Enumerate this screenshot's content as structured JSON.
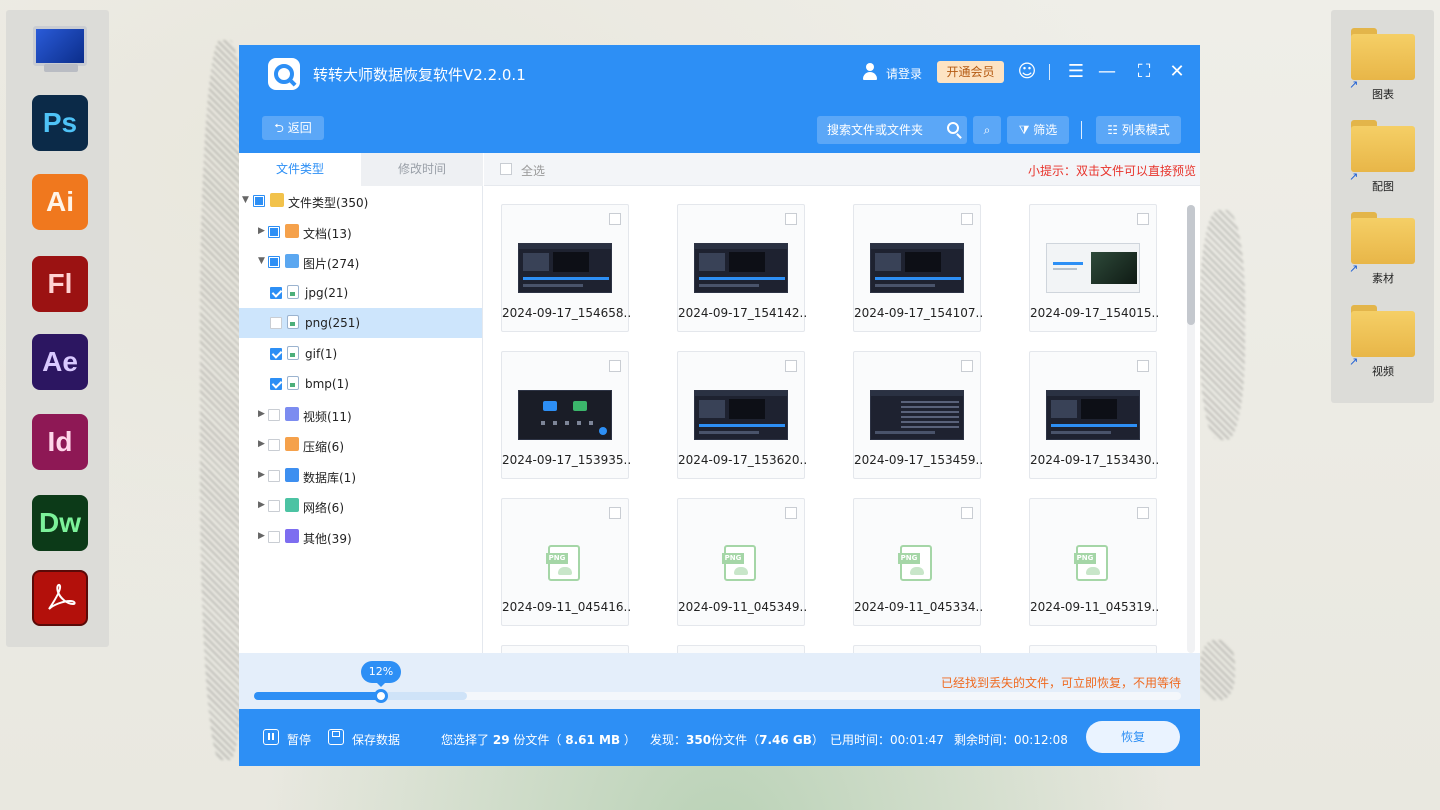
{
  "app": {
    "title": "转转大师数据恢复软件V2.2.0.1",
    "login_label": "请登录",
    "vip_label": "开通会员"
  },
  "toolbar": {
    "back_label": "返回",
    "search_placeholder": "搜索文件或文件夹",
    "filter_label": "筛选",
    "list_mode_label": "列表模式"
  },
  "tabs": [
    {
      "label": "文件类型",
      "active": true
    },
    {
      "label": "修改时间",
      "active": false
    }
  ],
  "tree": [
    {
      "label": "文件类型(350)",
      "level": 0,
      "expanded": true,
      "check": "partial",
      "icon": "folder-icon"
    },
    {
      "label": "文档(13)",
      "level": 1,
      "expanded": false,
      "check": "partial",
      "icon": "document-icon"
    },
    {
      "label": "图片(274)",
      "level": 1,
      "expanded": true,
      "check": "partial",
      "icon": "image-icon"
    },
    {
      "label": "jpg(21)",
      "level": 2,
      "check": "checked",
      "icon": "image-file-icon"
    },
    {
      "label": "png(251)",
      "level": 2,
      "check": "unchecked",
      "icon": "image-file-icon",
      "selected": true
    },
    {
      "label": "gif(1)",
      "level": 2,
      "check": "checked",
      "icon": "image-file-icon"
    },
    {
      "label": "bmp(1)",
      "level": 2,
      "check": "checked",
      "icon": "image-file-icon"
    },
    {
      "label": "视频(11)",
      "level": 1,
      "expanded": false,
      "check": "unchecked",
      "icon": "video-icon"
    },
    {
      "label": "压缩(6)",
      "level": 1,
      "expanded": false,
      "check": "unchecked",
      "icon": "archive-icon"
    },
    {
      "label": "数据库(1)",
      "level": 1,
      "expanded": false,
      "check": "unchecked",
      "icon": "database-icon"
    },
    {
      "label": "网络(6)",
      "level": 1,
      "expanded": false,
      "check": "unchecked",
      "icon": "network-icon"
    },
    {
      "label": "其他(39)",
      "level": 1,
      "expanded": false,
      "check": "unchecked",
      "icon": "other-icon"
    }
  ],
  "content": {
    "select_all_label": "全选",
    "hint": "小提示：双击文件可以直接预览"
  },
  "files": [
    {
      "name": "2024-09-17_154658...",
      "thumb": "editor"
    },
    {
      "name": "2024-09-17_154142...",
      "thumb": "editor"
    },
    {
      "name": "2024-09-17_154107...",
      "thumb": "editor"
    },
    {
      "name": "2024-09-17_154015...",
      "thumb": "light"
    },
    {
      "name": "2024-09-17_153935...",
      "thumb": "app"
    },
    {
      "name": "2024-09-17_153620...",
      "thumb": "editor"
    },
    {
      "name": "2024-09-17_153459...",
      "thumb": "table"
    },
    {
      "name": "2024-09-17_153430...",
      "thumb": "editor"
    },
    {
      "name": "2024-09-11_045416...",
      "thumb": "png"
    },
    {
      "name": "2024-09-11_045349...",
      "thumb": "png"
    },
    {
      "name": "2024-09-11_045334...",
      "thumb": "png"
    },
    {
      "name": "2024-09-11_045319...",
      "thumb": "png"
    }
  ],
  "progress": {
    "label": "12%",
    "value": 0.137,
    "buffered": 0.23,
    "note": "已经找到丢失的文件，可立即恢复，不用等待"
  },
  "status": {
    "pause_label": "暂停",
    "save_label": "保存数据",
    "selected_prefix": "您选择了",
    "selected_count": "29",
    "selected_mid": "份文件（",
    "selected_size": "8.61 MB",
    "selected_suffix": "）",
    "found_prefix": "发现：",
    "found_count": "350",
    "found_mid": "份文件（",
    "found_size": "7.46 GB",
    "found_suffix": "）",
    "elapsed": "已用时间：00:01:47",
    "remaining": "剩余时间：00:12:08",
    "recover_label": "恢复"
  },
  "desktop": {
    "left_dock": [
      {
        "icon": "computer-icon",
        "text": ""
      },
      {
        "icon": "photoshop-icon",
        "text": "Ps",
        "bg": "#0b2a48",
        "fg": "#4fc3f7"
      },
      {
        "icon": "illustrator-icon",
        "text": "Ai",
        "bg": "#f0781e",
        "fg": "#fff4e8"
      },
      {
        "icon": "flash-icon",
        "text": "Fl",
        "bg": "#9b1212",
        "fg": "#ffd2d2"
      },
      {
        "icon": "after-effects-icon",
        "text": "Ae",
        "bg": "#2c1661",
        "fg": "#d9c9ff"
      },
      {
        "icon": "indesign-icon",
        "text": "Id",
        "bg": "#8e1855",
        "fg": "#ffd6ea"
      },
      {
        "icon": "dreamweaver-icon",
        "text": "Dw",
        "bg": "#0c3a18",
        "fg": "#7cf29a"
      },
      {
        "icon": "acrobat-icon",
        "text": "",
        "bg": "#b3100b",
        "fg": "#ffffff"
      }
    ],
    "right_folders": [
      "图表",
      "配图",
      "素材",
      "视频"
    ]
  }
}
